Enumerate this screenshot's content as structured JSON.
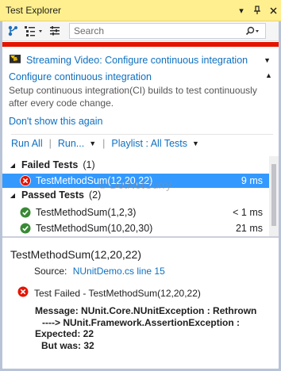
{
  "window": {
    "title": "Test Explorer"
  },
  "toolbar": {
    "search_placeholder": "Search"
  },
  "notification": {
    "streaming_label": "Streaming Video: Configure continuous integration",
    "title": "Configure continuous integration",
    "body_line1": "Setup continuous integration(CI) builds to test continuously",
    "body_line2": "after every code change.",
    "dont_show": "Don't show this again"
  },
  "runbar": {
    "run_all": "Run All",
    "run": "Run...",
    "playlist": "Playlist : All Tests"
  },
  "tree": {
    "failed": {
      "name": "Failed Tests",
      "count": "(1)"
    },
    "failed_items": [
      {
        "name": "TestMethodSum(12,20,22)",
        "time": "9 ms"
      }
    ],
    "passed": {
      "name": "Passed Tests",
      "count": "(2)"
    },
    "passed_items": [
      {
        "name": "TestMethodSum(1,2,3)",
        "time": "< 1 ms"
      },
      {
        "name": "TestMethodSum(10,20,30)",
        "time": "21 ms"
      }
    ]
  },
  "watermark": "© DotNetCurry",
  "detail": {
    "title": "TestMethodSum(12,20,22)",
    "source_label": "Source:",
    "source_link": "NUnitDemo.cs line 15",
    "failed_text": "Test Failed - TestMethodSum(12,20,22)",
    "msg1": "Message: NUnit.Core.NUnitException : Rethrown",
    "msg2": "----> NUnit.Framework.AssertionException :",
    "msg3": "Expected: 22",
    "msg4": "But was:  32"
  },
  "colors": {
    "title_bar": "#ffef8e",
    "error_bar": "#e51400",
    "link": "#0e70c0",
    "selection": "#3399ff",
    "fail": "#e51400",
    "pass": "#388a34"
  }
}
